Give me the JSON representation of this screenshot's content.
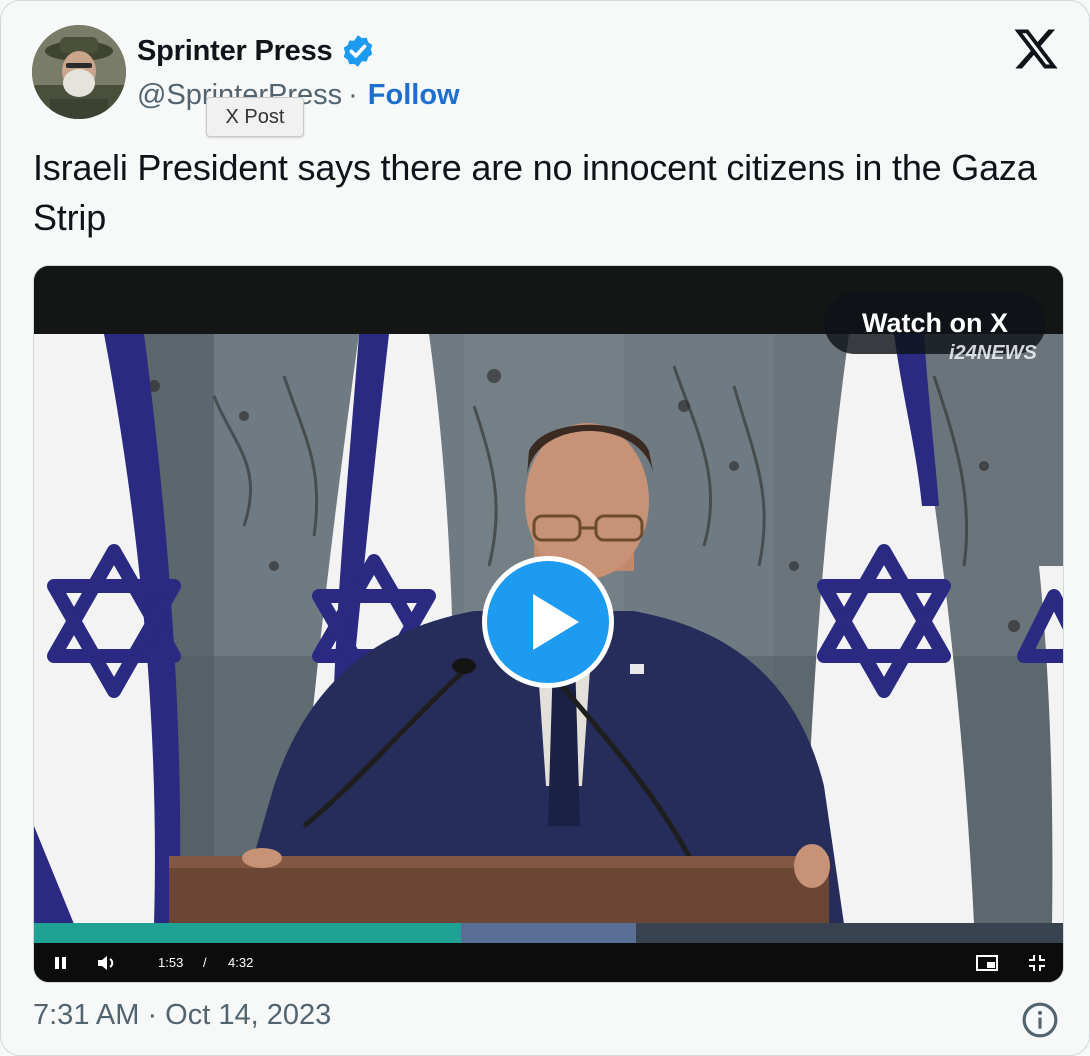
{
  "author": {
    "name": "Sprinter Press",
    "handle": "@SprinterPress",
    "separator": "·",
    "follow_label": "Follow",
    "verified_icon": "verified-badge-icon"
  },
  "tooltip": "X Post",
  "tweet": {
    "text": "Israeli President says there are no innocent citizens in the Gaza Strip"
  },
  "video": {
    "watch_label": "Watch on X",
    "channel_logo": "i24NEWS",
    "current_time": "1:53",
    "time_separator": "/",
    "duration": "4:32",
    "progress_fraction": 0.415,
    "buffered_fraction": 0.585
  },
  "footer": {
    "timestamp": "7:31 AM · Oct 14, 2023"
  },
  "colors": {
    "accent": "#1d9bf0",
    "follow": "#1d6fce",
    "progress": "#1fa293"
  }
}
